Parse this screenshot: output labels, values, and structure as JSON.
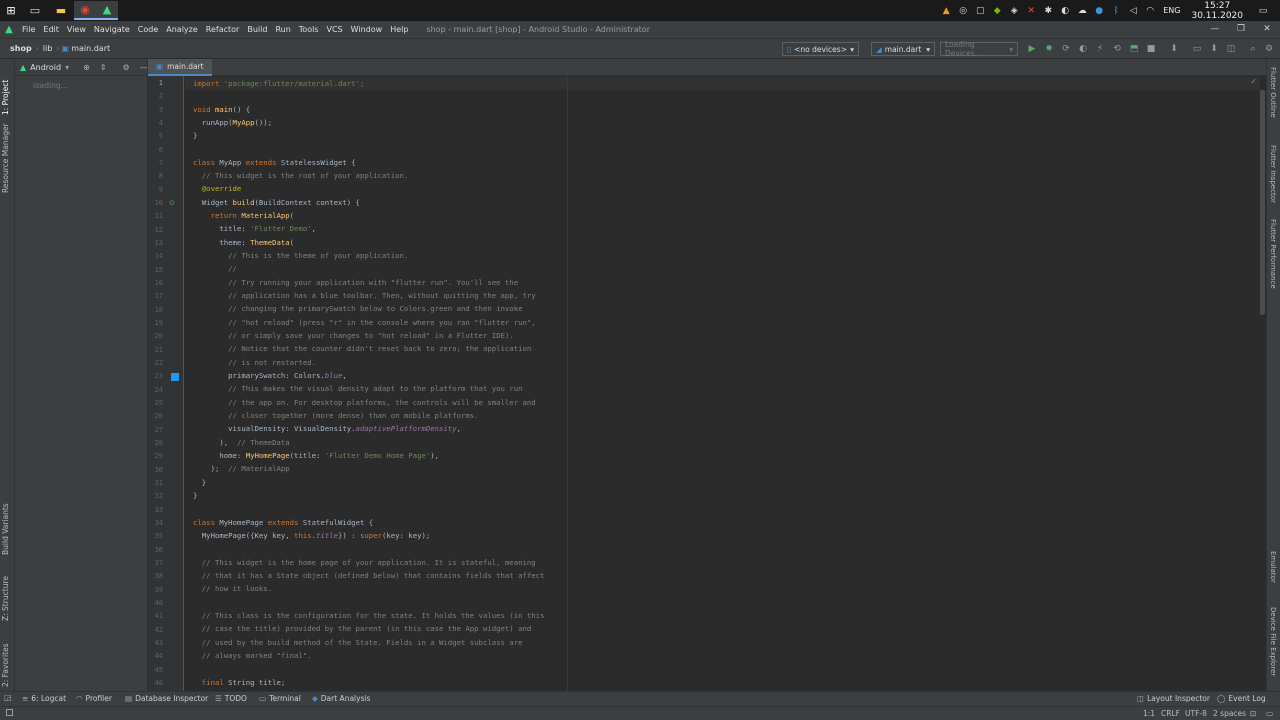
{
  "taskbar": {
    "apps": [
      "start",
      "desktop",
      "explorer",
      "chrome",
      "android-studio"
    ],
    "tray_lang": "ENG",
    "time": "15:27",
    "date": "30.11.2020"
  },
  "menubar": {
    "items": [
      "File",
      "Edit",
      "View",
      "Navigate",
      "Code",
      "Analyze",
      "Refactor",
      "Build",
      "Run",
      "Tools",
      "VCS",
      "Window",
      "Help"
    ],
    "title": "shop - main.dart [shop] - Android Studio - Administrator"
  },
  "navbar": {
    "crumbs": [
      "shop",
      "lib",
      "main.dart"
    ],
    "device": "<no devices>",
    "run_config": "main.dart",
    "loading": "Loading Devices..."
  },
  "project_panel": {
    "view": "Android",
    "loading": "loading..."
  },
  "left_tabs": [
    "1: Project",
    "Resource Manager",
    "Build Variants",
    "Z: Structure",
    "2: Favorites"
  ],
  "right_tabs": [
    "Flutter Outline",
    "Flutter Inspector",
    "Flutter Performance",
    "Emulator",
    "Device File Explorer"
  ],
  "editor": {
    "tab": "main.dart",
    "line_numbers": [
      "1",
      "2",
      "3",
      "4",
      "5",
      "6",
      "7",
      "8",
      "9",
      "10",
      "11",
      "12",
      "13",
      "14",
      "15",
      "16",
      "17",
      "18",
      "19",
      "20",
      "21",
      "22",
      "23",
      "24",
      "25",
      "26",
      "27",
      "28",
      "29",
      "30",
      "31",
      "32",
      "33",
      "34",
      "35",
      "36",
      "37",
      "38",
      "39",
      "40",
      "41",
      "42",
      "43",
      "44",
      "45",
      "46"
    ],
    "code": {
      "l1_kw": "import",
      "l1_str": " 'package:flutter/material.dart';",
      "l3_kw": "void",
      "l3_fn": " main",
      "l3_rest": "() {",
      "l4": "  runApp(",
      "l4_fn": "MyApp",
      "l4_rest": "());",
      "l5": "}",
      "l7_kw": "class",
      "l7_mid": " MyApp ",
      "l7_kw2": "extends",
      "l7_rest": " StatelessWidget {",
      "l8": "  // This widget is the root of your application.",
      "l9": "  @override",
      "l10": "  Widget ",
      "l10_fn": "build",
      "l10_rest": "(BuildContext context) {",
      "l11_kw": "    return",
      "l11_fn": " MaterialApp",
      "l11_rest": "(",
      "l12": "      title: ",
      "l12_str": "'Flutter Demo'",
      "l12_rest": ",",
      "l13": "      theme: ",
      "l13_fn": "ThemeData",
      "l13_rest": "(",
      "l14": "        // This is the theme of your application.",
      "l15": "        //",
      "l16": "        // Try running your application with \"flutter run\". You'll see the",
      "l17": "        // application has a blue toolbar. Then, without quitting the app, try",
      "l18": "        // changing the primarySwatch below to Colors.green and then invoke",
      "l19": "        // \"hot reload\" (press \"r\" in the console where you ran \"flutter run\",",
      "l20": "        // or simply save your changes to \"hot reload\" in a Flutter IDE).",
      "l21": "        // Notice that the counter didn't reset back to zero; the application",
      "l22": "        // is not restarted.",
      "l23": "        primarySwatch: Colors.",
      "l23_it": "blue",
      "l23_rest": ",",
      "l24": "        // This makes the visual density adapt to the platform that you run",
      "l25": "        // the app on. For desktop platforms, the controls will be smaller and",
      "l26": "        // closer together (more dense) than on mobile platforms.",
      "l27": "        visualDensity: VisualDensity.",
      "l27_it": "adaptivePlatformDensity",
      "l27_rest": ",",
      "l28": "      ),  ",
      "l28_c": "// ThemeData",
      "l29": "      home: ",
      "l29_fn": "MyHomePage",
      "l29_mid": "(title: ",
      "l29_str": "'Flutter Demo Home Page'",
      "l29_rest": "),",
      "l30": "    );  ",
      "l30_c": "// MaterialApp",
      "l31": "  }",
      "l32": "}",
      "l34_kw": "class",
      "l34_mid": " MyHomePage ",
      "l34_kw2": "extends",
      "l34_rest": " StatefulWidget {",
      "l35": "  MyHomePage({Key key, ",
      "l35_kw": "this",
      "l35_mid": ".",
      "l35_it": "title",
      "l35_mid2": "}) : ",
      "l35_kw2": "super",
      "l35_rest": "(key: key);",
      "l37": "  // This widget is the home page of your application. It is stateful, meaning",
      "l38": "  // that it has a State object (defined below) that contains fields that affect",
      "l39": "  // how it looks.",
      "l41": "  // This class is the configuration for the state. It holds the values (in this",
      "l42": "  // case the title) provided by the parent (in this case the App widget) and",
      "l43": "  // used by the build method of the State. Fields in a Widget subclass are",
      "l44": "  // always marked \"final\".",
      "l46_kw": "  final",
      "l46_rest": " String title;"
    }
  },
  "bottom_tabs": [
    "6: Logcat",
    "Profiler",
    "Database Inspector",
    "TODO",
    "Terminal",
    "Dart Analysis",
    "Layout Inspector",
    "Event Log"
  ],
  "status": {
    "position": "1:1",
    "line_sep": "CRLF",
    "encoding": "UTF-8",
    "indent": "2 spaces"
  },
  "colors": {
    "accent": "#4a88c7",
    "android_green": "#3ddc84",
    "run_green": "#59a869"
  }
}
